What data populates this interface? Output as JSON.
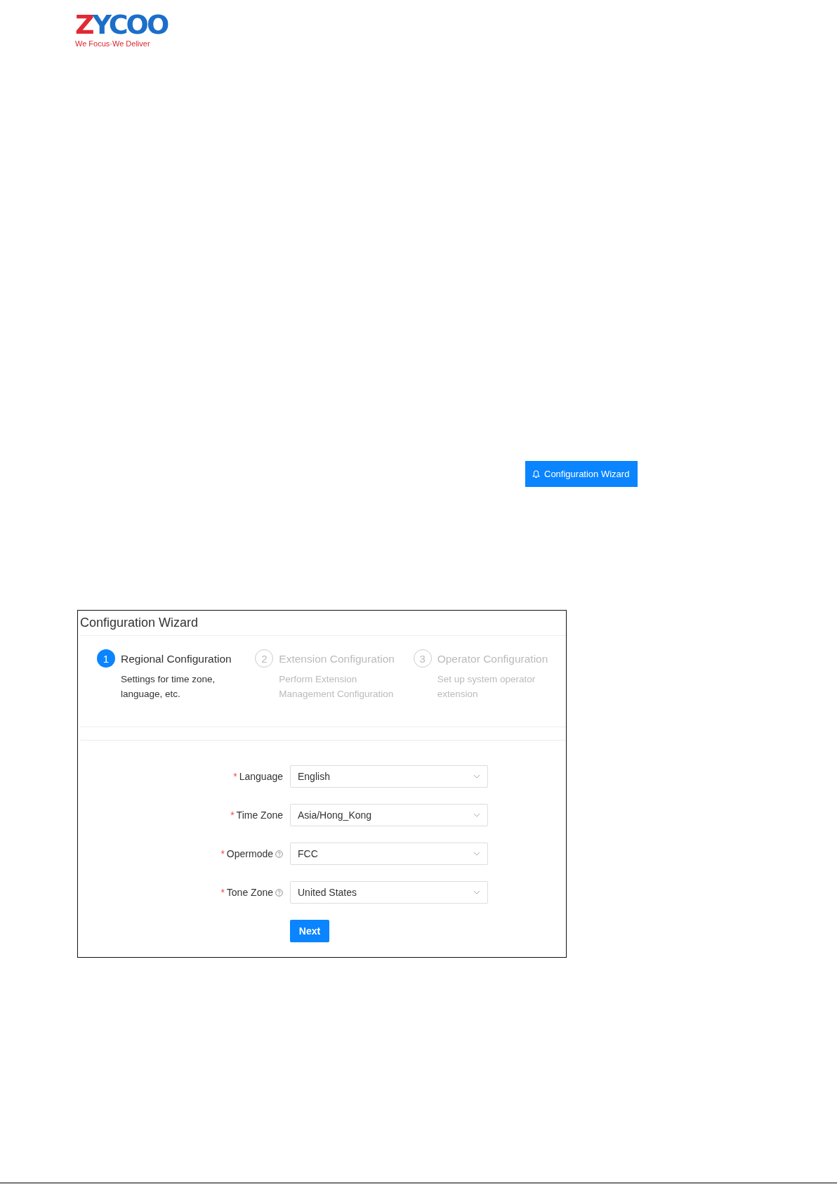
{
  "logo": {
    "name": "ZYCOO",
    "tagline": "We Focus·We Deliver"
  },
  "wizard_button": {
    "label": "Configuration Wizard"
  },
  "wizard": {
    "title": "Configuration Wizard",
    "steps": [
      {
        "number": "1",
        "title": "Regional Configuration",
        "description": "Settings for time zone, language, etc.",
        "selected": true
      },
      {
        "number": "2",
        "title": "Extension Configuration",
        "description": "Perform Extension Management Configuration",
        "selected": false
      },
      {
        "number": "3",
        "title": "Operator Configuration",
        "description": "Set up system operator extension",
        "selected": false
      }
    ],
    "fields": [
      {
        "required_mark": "*",
        "label": "Language",
        "help": false,
        "value": "English"
      },
      {
        "required_mark": "*",
        "label": "Time Zone",
        "help": false,
        "value": "Asia/Hong_Kong"
      },
      {
        "required_mark": "*",
        "label": "Opermode",
        "help": true,
        "value": "FCC"
      },
      {
        "required_mark": "*",
        "label": "Tone Zone",
        "help": true,
        "value": "United States"
      }
    ],
    "next_button": "Next"
  }
}
